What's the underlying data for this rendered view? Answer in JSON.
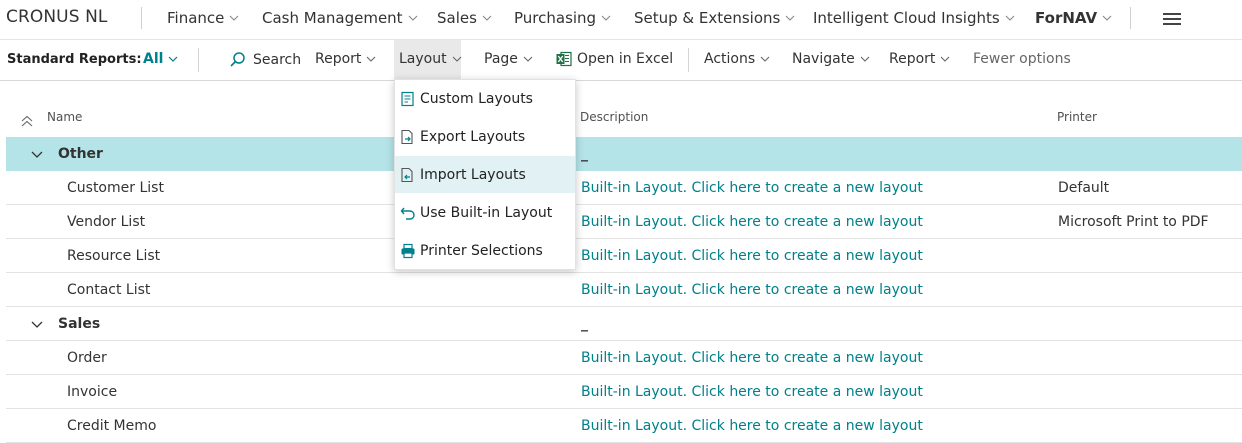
{
  "topnav": {
    "company": "CRONUS NL",
    "items": [
      {
        "label": "Finance"
      },
      {
        "label": "Cash Management"
      },
      {
        "label": "Sales"
      },
      {
        "label": "Purchasing"
      },
      {
        "label": "Setup & Extensions"
      },
      {
        "label": "Intelligent Cloud Insights"
      },
      {
        "label": "ForNAV"
      }
    ]
  },
  "actionbar": {
    "label": "Standard Reports:",
    "filter_all": "All",
    "search": "Search",
    "report": "Report",
    "layout": "Layout",
    "page": "Page",
    "open_in_excel": "Open in Excel",
    "actions": "Actions",
    "navigate": "Navigate",
    "report2": "Report",
    "fewer_options": "Fewer options"
  },
  "grid": {
    "headers": {
      "name": "Name",
      "description": "Description",
      "printer": "Printer"
    },
    "rows": [
      {
        "type": "group",
        "name": "Other",
        "description": "_",
        "printer": ""
      },
      {
        "type": "item",
        "name": "Customer List",
        "description": "Built-in Layout. Click here to create a new layout",
        "printer": "Default"
      },
      {
        "type": "item",
        "name": "Vendor List",
        "description": "Built-in Layout. Click here to create a new layout",
        "printer": "Microsoft Print to PDF"
      },
      {
        "type": "item",
        "name": "Resource List",
        "description": "Built-in Layout. Click here to create a new layout",
        "printer": ""
      },
      {
        "type": "item",
        "name": "Contact List",
        "description": "Built-in Layout. Click here to create a new layout",
        "printer": ""
      },
      {
        "type": "group",
        "name": "Sales",
        "description": "_",
        "printer": ""
      },
      {
        "type": "item",
        "name": "Order",
        "description": "Built-in Layout. Click here to create a new layout",
        "printer": ""
      },
      {
        "type": "item",
        "name": "Invoice",
        "description": "Built-in Layout. Click here to create a new layout",
        "printer": ""
      },
      {
        "type": "item",
        "name": "Credit Memo",
        "description": "Built-in Layout. Click here to create a new layout",
        "printer": ""
      }
    ]
  },
  "layout_menu": {
    "items": [
      {
        "label": "Custom Layouts",
        "icon": "custom-layouts-icon"
      },
      {
        "label": "Export Layouts",
        "icon": "export-layouts-icon"
      },
      {
        "label": "Import Layouts",
        "icon": "import-layouts-icon"
      },
      {
        "label": "Use Built-in Layout",
        "icon": "undo-icon"
      },
      {
        "label": "Printer Selections",
        "icon": "printer-icon"
      }
    ]
  },
  "colors": {
    "accent": "#00808a",
    "selected_row": "#b4e4e8",
    "menu_hover": "#e2f2f4"
  }
}
